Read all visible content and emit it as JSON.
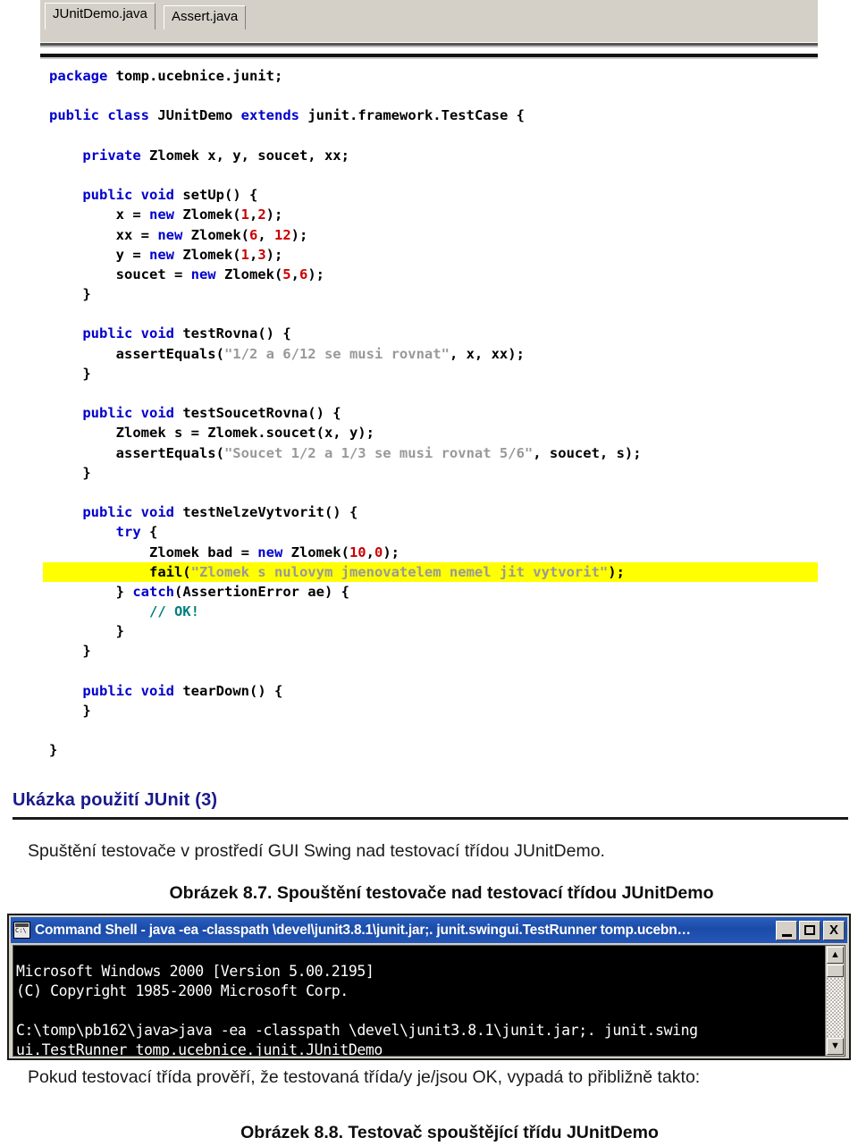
{
  "editor": {
    "tabs": [
      {
        "label": "JUnitDemo.java",
        "active": true
      },
      {
        "label": "Assert.java",
        "active": false
      }
    ],
    "code_lines": [
      [
        {
          "t": "package",
          "c": "kw"
        },
        {
          "t": " tomp.ucebnice.junit;",
          "c": "pl"
        }
      ],
      [],
      [
        {
          "t": "public",
          "c": "kw"
        },
        {
          "t": " ",
          "c": "pl"
        },
        {
          "t": "class",
          "c": "kw"
        },
        {
          "t": " JUnitDemo ",
          "c": "pl"
        },
        {
          "t": "extends",
          "c": "kw"
        },
        {
          "t": " junit.framework.TestCase {",
          "c": "pl"
        }
      ],
      [],
      [
        {
          "t": "    ",
          "c": "pl"
        },
        {
          "t": "private",
          "c": "kw"
        },
        {
          "t": " Zlomek x, y, soucet, xx;",
          "c": "pl"
        }
      ],
      [],
      [
        {
          "t": "    ",
          "c": "pl"
        },
        {
          "t": "public",
          "c": "kw"
        },
        {
          "t": " ",
          "c": "pl"
        },
        {
          "t": "void",
          "c": "kw"
        },
        {
          "t": " setUp() {",
          "c": "pl"
        }
      ],
      [
        {
          "t": "        x = ",
          "c": "pl"
        },
        {
          "t": "new",
          "c": "kw"
        },
        {
          "t": " Zlomek(",
          "c": "pl"
        },
        {
          "t": "1",
          "c": "num"
        },
        {
          "t": ",",
          "c": "pl"
        },
        {
          "t": "2",
          "c": "num"
        },
        {
          "t": ");",
          "c": "pl"
        }
      ],
      [
        {
          "t": "        xx = ",
          "c": "pl"
        },
        {
          "t": "new",
          "c": "kw"
        },
        {
          "t": " Zlomek(",
          "c": "pl"
        },
        {
          "t": "6",
          "c": "num"
        },
        {
          "t": ", ",
          "c": "pl"
        },
        {
          "t": "12",
          "c": "num"
        },
        {
          "t": ");",
          "c": "pl"
        }
      ],
      [
        {
          "t": "        y = ",
          "c": "pl"
        },
        {
          "t": "new",
          "c": "kw"
        },
        {
          "t": " Zlomek(",
          "c": "pl"
        },
        {
          "t": "1",
          "c": "num"
        },
        {
          "t": ",",
          "c": "pl"
        },
        {
          "t": "3",
          "c": "num"
        },
        {
          "t": ");",
          "c": "pl"
        }
      ],
      [
        {
          "t": "        soucet = ",
          "c": "pl"
        },
        {
          "t": "new",
          "c": "kw"
        },
        {
          "t": " Zlomek(",
          "c": "pl"
        },
        {
          "t": "5",
          "c": "num"
        },
        {
          "t": ",",
          "c": "pl"
        },
        {
          "t": "6",
          "c": "num"
        },
        {
          "t": ");",
          "c": "pl"
        }
      ],
      [
        {
          "t": "    }",
          "c": "pl"
        }
      ],
      [],
      [
        {
          "t": "    ",
          "c": "pl"
        },
        {
          "t": "public",
          "c": "kw"
        },
        {
          "t": " ",
          "c": "pl"
        },
        {
          "t": "void",
          "c": "kw"
        },
        {
          "t": " testRovna() {",
          "c": "pl"
        }
      ],
      [
        {
          "t": "        assertEquals(",
          "c": "pl"
        },
        {
          "t": "\"1/2 a 6/12 se musi rovnat\"",
          "c": "str"
        },
        {
          "t": ", x, xx);",
          "c": "pl"
        }
      ],
      [
        {
          "t": "    }",
          "c": "pl"
        }
      ],
      [],
      [
        {
          "t": "    ",
          "c": "pl"
        },
        {
          "t": "public",
          "c": "kw"
        },
        {
          "t": " ",
          "c": "pl"
        },
        {
          "t": "void",
          "c": "kw"
        },
        {
          "t": " testSoucetRovna() {",
          "c": "pl"
        }
      ],
      [
        {
          "t": "        Zlomek s = Zlomek.soucet(x, y);",
          "c": "pl"
        }
      ],
      [
        {
          "t": "        assertEquals(",
          "c": "pl"
        },
        {
          "t": "\"Soucet 1/2 a 1/3 se musi rovnat 5/6\"",
          "c": "str"
        },
        {
          "t": ", soucet, s);",
          "c": "pl"
        }
      ],
      [
        {
          "t": "    }",
          "c": "pl"
        }
      ],
      [],
      [
        {
          "t": "    ",
          "c": "pl"
        },
        {
          "t": "public",
          "c": "kw"
        },
        {
          "t": " ",
          "c": "pl"
        },
        {
          "t": "void",
          "c": "kw"
        },
        {
          "t": " testNelzeVytvorit() {",
          "c": "pl"
        }
      ],
      [
        {
          "t": "        ",
          "c": "pl"
        },
        {
          "t": "try",
          "c": "kw"
        },
        {
          "t": " {",
          "c": "pl"
        }
      ],
      [
        {
          "t": "            Zlomek bad = ",
          "c": "pl"
        },
        {
          "t": "new",
          "c": "kw"
        },
        {
          "t": " Zlomek(",
          "c": "pl"
        },
        {
          "t": "10",
          "c": "num"
        },
        {
          "t": ",",
          "c": "pl"
        },
        {
          "t": "0",
          "c": "num"
        },
        {
          "t": ");",
          "c": "pl"
        }
      ],
      [
        {
          "t": "            fail(",
          "c": "pl"
        },
        {
          "t": "\"Zlomek s nulovym jmenovatelem nemel jit vytvorit\"",
          "c": "str"
        },
        {
          "t": ");",
          "c": "pl"
        }
      ],
      [
        {
          "t": "        } ",
          "c": "pl"
        },
        {
          "t": "catch",
          "c": "kw"
        },
        {
          "t": "(AssertionError ae) {",
          "c": "pl"
        }
      ],
      [
        {
          "t": "            ",
          "c": "pl"
        },
        {
          "t": "// OK!",
          "c": "cmt"
        }
      ],
      [
        {
          "t": "        }",
          "c": "pl"
        }
      ],
      [
        {
          "t": "    }",
          "c": "pl"
        }
      ],
      [],
      [
        {
          "t": "    ",
          "c": "pl"
        },
        {
          "t": "public",
          "c": "kw"
        },
        {
          "t": " ",
          "c": "pl"
        },
        {
          "t": "void",
          "c": "kw"
        },
        {
          "t": " tearDown() {",
          "c": "pl"
        }
      ],
      [
        {
          "t": "    }",
          "c": "pl"
        }
      ],
      [],
      [
        {
          "t": "}",
          "c": "pl"
        }
      ]
    ],
    "highlighted_line_index": 25
  },
  "slide": {
    "heading": "Ukázka použití JUnit (3)",
    "paragraph_1": "Spuštění testovače v prostředí GUI Swing nad testovací třídou JUnitDemo.",
    "caption_1": "Obrázek 8.7. Spouštění testovače nad testovací třídou JUnitDemo",
    "paragraph_2": "Pokud testovací třída prověří, že testovaná třída/y je/jsou OK, vypadá to přibližně takto:",
    "caption_2": "Obrázek 8.8. Testovač spouštějící třídu JUnitDemo"
  },
  "console": {
    "title": "Command Shell - java -ea -classpath \\devel\\junit3.8.1\\junit.jar;. junit.swingui.TestRunner tomp.ucebn…",
    "buttons": {
      "minimize": "_",
      "maximize": "□",
      "close": "X"
    },
    "output": "Microsoft Windows 2000 [Version 5.00.2195]\n(C) Copyright 1985-2000 Microsoft Corp.\n\nC:\\tomp\\pb162\\java>java -ea -classpath \\devel\\junit3.8.1\\junit.jar;. junit.swing\nui.TestRunner tomp.ucebnice.junit.JUnitDemo",
    "scrollbar": {
      "up_arrow": "▲",
      "down_arrow": "▼"
    }
  },
  "colors": {
    "keyword": "#0000cc",
    "number": "#cc0000",
    "string": "#999999",
    "comment": "#008080",
    "highlight": "#ffff00",
    "heading": "#1a1a8c",
    "titlebar": "#1b4ba8"
  }
}
